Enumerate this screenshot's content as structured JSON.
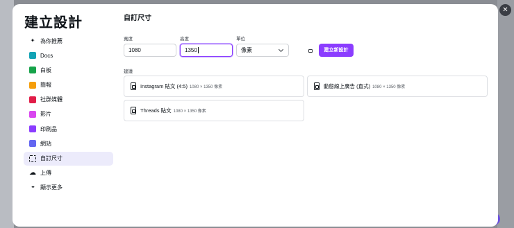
{
  "modal": {
    "title": "建立設計",
    "close_icon": "✕"
  },
  "sidebar": {
    "items": [
      {
        "label": "為你推薦",
        "icon": "sparkle-icon",
        "color": "#0e1318",
        "glyph": "✦"
      },
      {
        "label": "Docs",
        "icon": "docs-icon",
        "color": "#13a3b5",
        "glyph": ""
      },
      {
        "label": "白板",
        "icon": "whiteboard-icon",
        "color": "#16a34a",
        "glyph": ""
      },
      {
        "label": "簡報",
        "icon": "presentation-icon",
        "color": "#f59e0b",
        "glyph": ""
      },
      {
        "label": "社群媒體",
        "icon": "heart-icon",
        "color": "#e11d48",
        "glyph": ""
      },
      {
        "label": "影片",
        "icon": "video-icon",
        "color": "#d946ef",
        "glyph": ""
      },
      {
        "label": "印刷品",
        "icon": "print-icon",
        "color": "#8b3dff",
        "glyph": ""
      },
      {
        "label": "網站",
        "icon": "website-icon",
        "color": "#6366f1",
        "glyph": ""
      },
      {
        "label": "自訂尺寸",
        "icon": "custom-size-icon",
        "color": "#0e1318",
        "glyph": "⬚",
        "active": true
      },
      {
        "label": "上傳",
        "icon": "upload-cloud-icon",
        "color": "#0e1318",
        "glyph": "☁"
      },
      {
        "label": "顯示更多",
        "icon": "more-dots-icon",
        "color": "#0e1318",
        "glyph": "•••"
      }
    ]
  },
  "main": {
    "title": "自訂尺寸",
    "width": {
      "label": "寬度",
      "value": "1080"
    },
    "height": {
      "label": "高度",
      "value": "1350"
    },
    "unit": {
      "label": "單位",
      "value": "像素"
    },
    "lock_icon": "🔒",
    "create_button": "建立新設計",
    "suggestions_label": "建議",
    "suggestions": [
      {
        "name": "Instagram 貼文 (4:5)",
        "dims": "1080 × 1350 像素"
      },
      {
        "name": "動態線上廣告 (直式)",
        "dims": "1080 × 1350 像素"
      },
      {
        "name": "Threads 貼文",
        "dims": "1080 × 1350 像素"
      }
    ]
  }
}
